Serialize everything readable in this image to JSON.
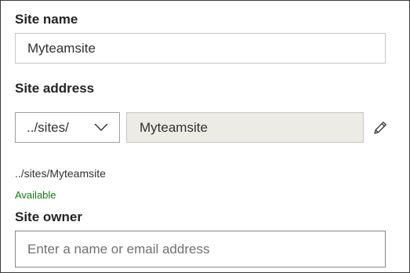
{
  "site_name": {
    "label": "Site name",
    "value": "Myteamsite"
  },
  "site_address": {
    "label": "Site address",
    "prefix_selected": "../sites/",
    "value": "Myteamsite",
    "full_path": "../sites/Myteamsite",
    "status": "Available",
    "status_color": "#107c10"
  },
  "site_owner": {
    "label": "Site owner",
    "placeholder": "Enter a name or email address"
  },
  "icons": {
    "dropdown": "chevron-down-icon",
    "edit": "pencil-icon"
  }
}
